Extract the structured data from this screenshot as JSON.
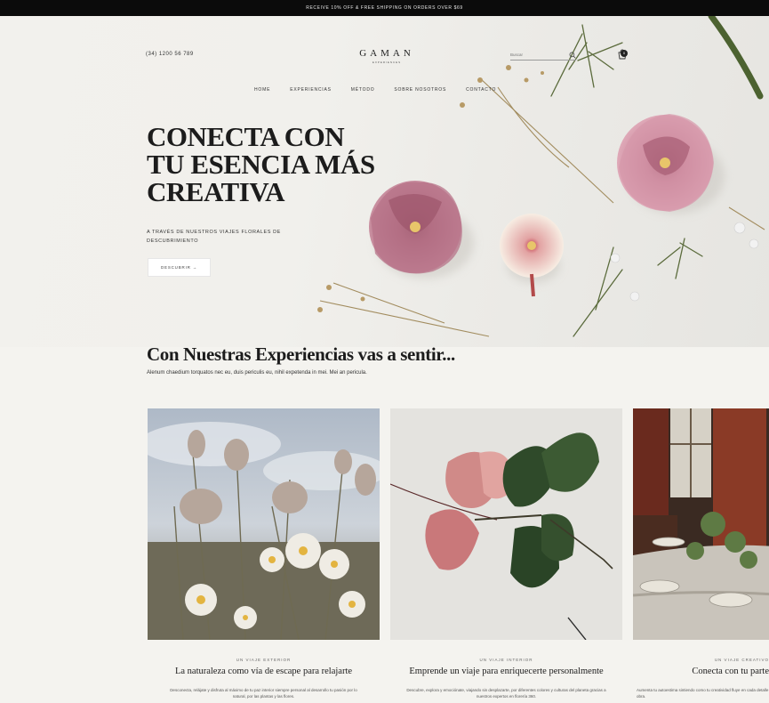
{
  "promo_bar": {
    "text": "RECEIVE 10% OFF & FREE SHIPPING ON ORDERS OVER $69"
  },
  "header": {
    "phone": "(34) 1200 56 789",
    "logo": "GAMAN",
    "logo_sub": "EXPERIENCES",
    "search_placeholder": "Buscar",
    "cart_count": "0"
  },
  "nav": {
    "items": [
      {
        "label": "HOME"
      },
      {
        "label": "EXPERIENCIAS"
      },
      {
        "label": "MÉTODO"
      },
      {
        "label": "SOBRE NOSOTROS"
      },
      {
        "label": "CONTACTO"
      }
    ]
  },
  "hero": {
    "title_lines": [
      "CONECTA CON",
      "TU ESENCIA MÁS",
      "CREATIVA"
    ],
    "subtitle": "A TRAVÉS DE NUESTROS VIAJES FLORALES DE DESCUBRIMIENTO",
    "button_label": "DESCUBRIR →"
  },
  "experiences": {
    "title": "Con Nuestras Experiencias vas a sentir...",
    "description": "Alenum chaedium torquatos nec eu, duis periculis eu, nihil expetenda in mei. Mei an pericula."
  },
  "cards": [
    {
      "kicker": "UN VIAJE EXTERIOR",
      "title": "La naturaleza como vía de escape para relajarte",
      "text": "Desconecta, relájate y disfruta al máximo de tu paz interior siempre personal al desarrollo tu pasión por lo natural, por las plantas y las flores."
    },
    {
      "kicker": "UN VIAJE INTERIOR",
      "title": "Emprende un viaje para enriquecerte personalmente",
      "text": "Descubre, explora y emociónate, viajando sin desplazarte, por diferentes colores y culturas del planeta gracias a nuestros expertos en florería 360."
    },
    {
      "kicker": "UN VIAJE CREATIVO",
      "title": "Conecta con tu parte",
      "text": "Aumenta tu autoestima sintiendo como tu creatividad fluye en cada detalle de tu obra."
    }
  ],
  "colors": {
    "promo_bg": "#0b0b0b",
    "page_bg": "#f4f3ef",
    "accent_flower": "#b57386"
  }
}
